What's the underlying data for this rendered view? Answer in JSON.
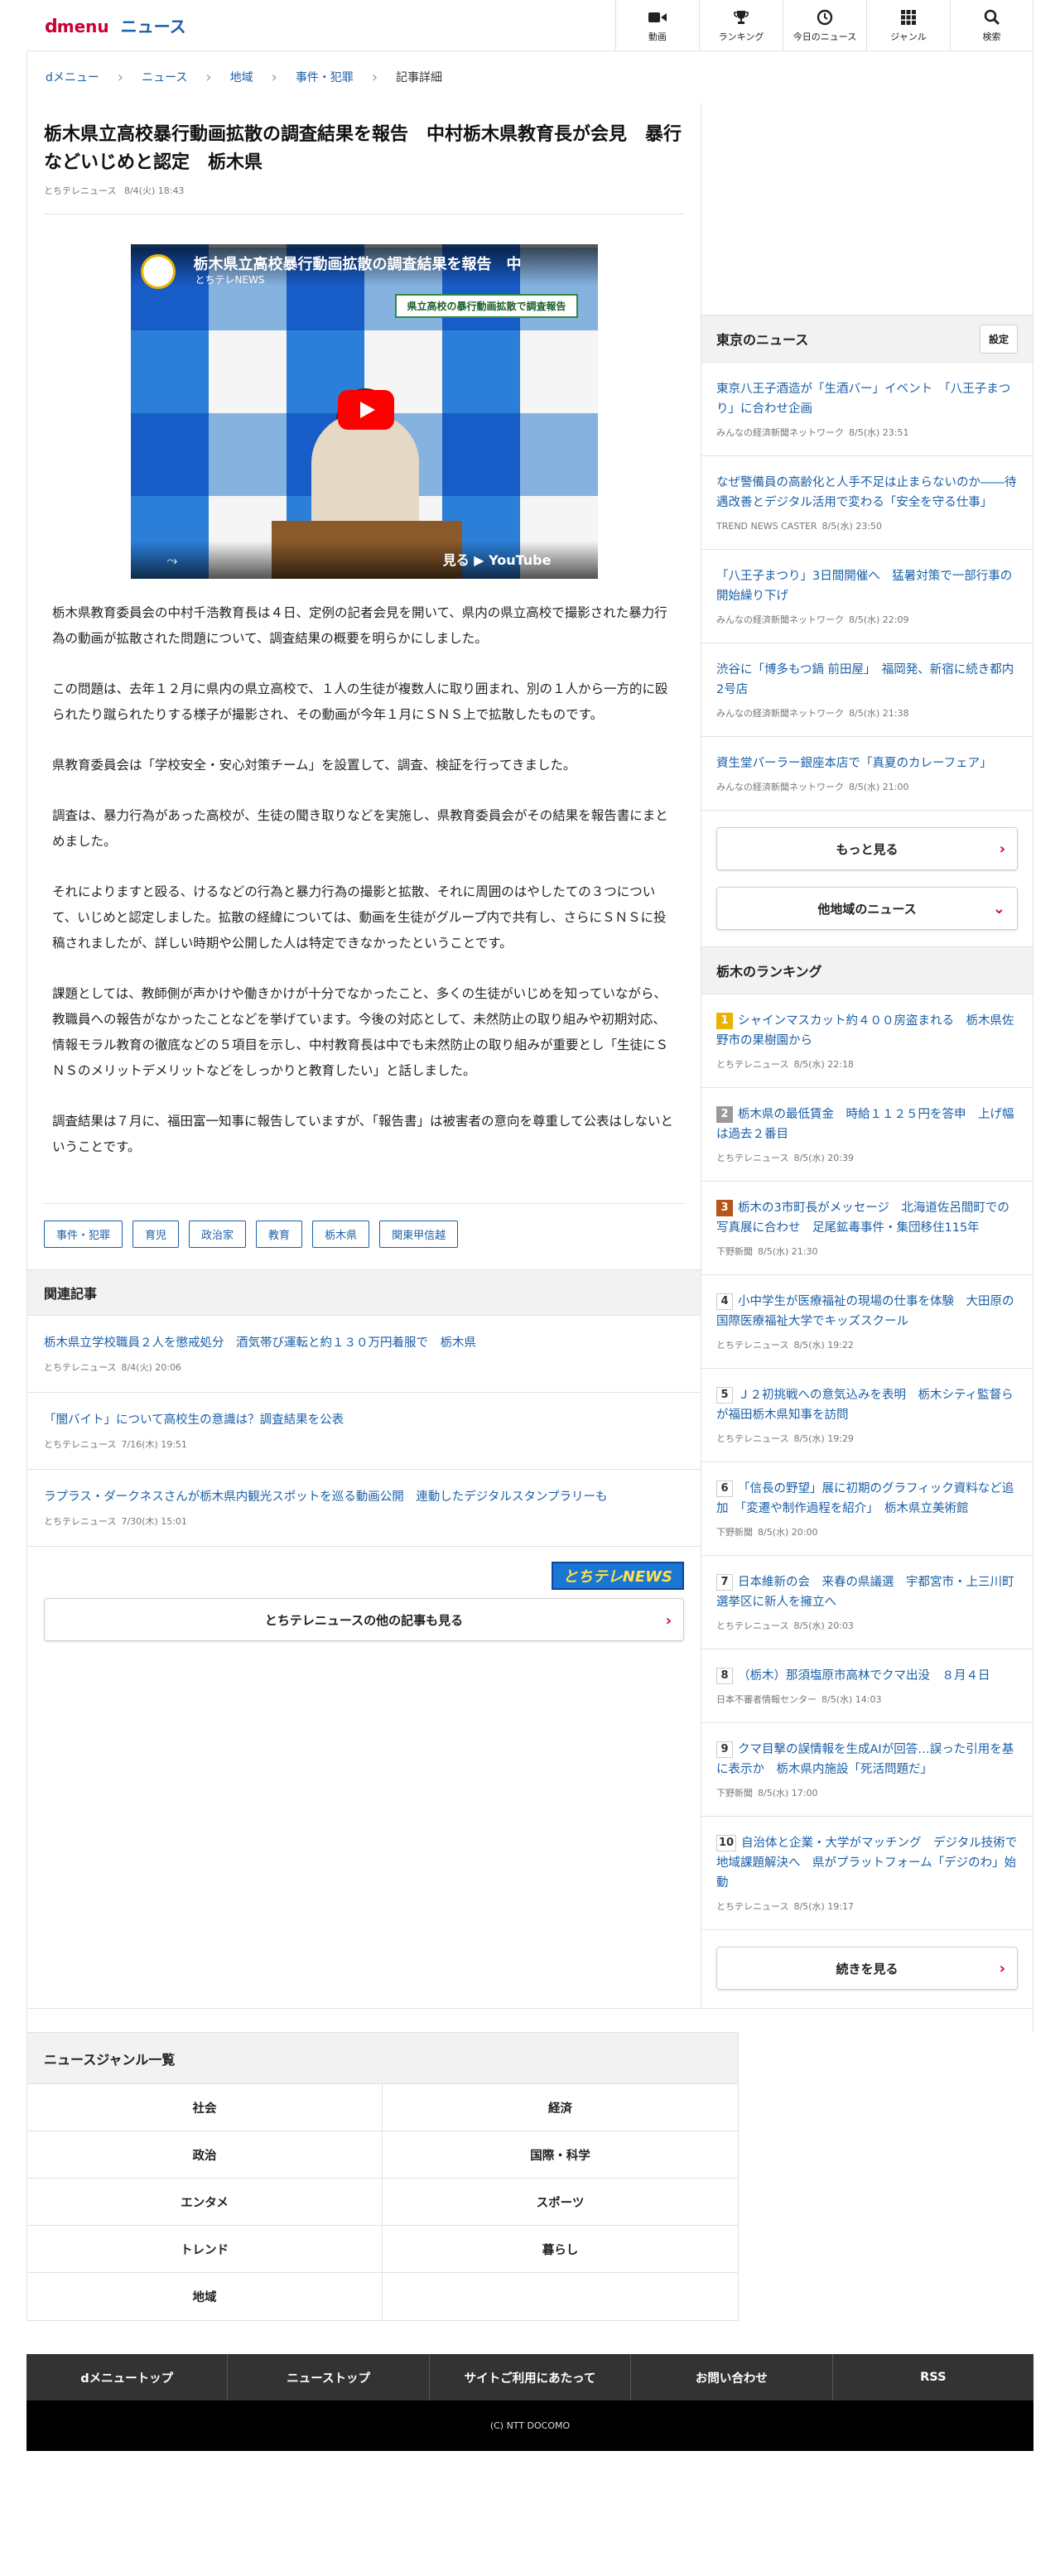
{
  "header": {
    "logo_d": "d",
    "logo_menu": "menu",
    "logo_news": "ニュース",
    "nav": [
      {
        "label": "動画",
        "icon": "video-camera-icon"
      },
      {
        "label": "ランキング",
        "icon": "trophy-icon"
      },
      {
        "label": "今日のニュース",
        "icon": "clock-icon"
      },
      {
        "label": "ジャンル",
        "icon": "grid-icon"
      },
      {
        "label": "検索",
        "icon": "search-icon"
      }
    ]
  },
  "breadcrumb": [
    "dメニュー",
    "ニュース",
    "地域",
    "事件・犯罪",
    "記事詳細"
  ],
  "article": {
    "title": "栃木県立高校暴行動画拡散の調査結果を報告　中村栃木県教育長が会見　暴行などいじめと認定　栃木県",
    "source": "とちテレニュース",
    "date": "8/4(火) 18:43",
    "video": {
      "title": "栃木県立高校暴行動画拡散の調査結果を報告　中",
      "channel": "とちテレNEWS",
      "banner": "県立高校の暴行動画拡散で調査報告",
      "share": "⤳",
      "watch": "見る ▶ YouTube"
    },
    "paragraphs": [
      "栃木県教育委員会の中村千浩教育長は４日、定例の記者会見を開いて、県内の県立高校で撮影された暴力行為の動画が拡散された問題について、調査結果の概要を明らかにしました。",
      "この問題は、去年１２月に県内の県立高校で、１人の生徒が複数人に取り囲まれ、別の１人から一方的に殴られたり蹴られたりする様子が撮影され、その動画が今年１月にＳＮＳ上で拡散したものです。",
      "県教育委員会は「学校安全・安心対策チーム」を設置して、調査、検証を行ってきました。",
      "調査は、暴力行為があった高校が、生徒の聞き取りなどを実施し、県教育委員会がその結果を報告書にまとめました。",
      "それによりますと殴る、けるなどの行為と暴力行為の撮影と拡散、それに周囲のはやしたての３つについて、いじめと認定しました。拡散の経緯については、動画を生徒がグループ内で共有し、さらにＳＮＳに投稿されましたが、詳しい時期や公開した人は特定できなかったということです。",
      "課題としては、教師側が声かけや働きかけが十分でなかったこと、多くの生徒がいじめを知っていながら、教職員への報告がなかったことなどを挙げています。今後の対応として、未然防止の取り組みや初期対応、情報モラル教育の徹底などの５項目を示し、中村教育長は中でも未然防止の取り組みが重要とし「生徒にＳＮＳのメリットデメリットなどをしっかりと教育したい」と話しました。",
      "調査結果は７月に、福田富一知事に報告していますが、「報告書」は被害者の意向を尊重して公表はしないということです。"
    ],
    "tags": [
      "事件・犯罪",
      "育児",
      "政治家",
      "教育",
      "栃木県",
      "関東甲信越"
    ]
  },
  "related": {
    "title": "関連記事",
    "items": [
      {
        "title": "栃木県立学校職員２人を懲戒処分　酒気帯び運転と約１３０万円着服で　栃木県",
        "source": "とちテレニュース",
        "date": "8/4(火) 20:06"
      },
      {
        "title": "「闇バイト」について高校生の意識は？調査結果を公表",
        "source": "とちテレニュース",
        "date": "7/16(木) 19:51"
      },
      {
        "title": "ラプラス・ダークネスさんが栃木県内観光スポットを巡る動画公開　連動したデジタルスタンプラリーも",
        "source": "とちテレニュース",
        "date": "7/30(木) 15:01"
      }
    ],
    "source_logo": "とちテレNEWS",
    "more": "とちテレニュースの他の記事も見る"
  },
  "tokyo": {
    "title": "東京のニュース",
    "setting": "設定",
    "items": [
      {
        "title": "東京八王子酒造が「生酒バー」イベント　「八王子まつり」に合わせ企画",
        "source": "みんなの経済新聞ネットワーク",
        "date": "8/5(水) 23:51"
      },
      {
        "title": "なぜ警備員の高齢化と人手不足は止まらないのか――待遇改善とデジタル活用で変わる「安全を守る仕事」",
        "source": "TREND NEWS CASTER",
        "date": "8/5(水) 23:50"
      },
      {
        "title": "「八王子まつり」3日間開催へ　猛暑対策で一部行事の開始繰り下げ",
        "source": "みんなの経済新聞ネットワーク",
        "date": "8/5(水) 22:09"
      },
      {
        "title": "渋谷に「博多もつ鍋 前田屋」　福岡発、新宿に続き都内2号店",
        "source": "みんなの経済新聞ネットワーク",
        "date": "8/5(水) 21:38"
      },
      {
        "title": "資生堂パーラー銀座本店で「真夏のカレーフェア」",
        "source": "みんなの経済新聞ネットワーク",
        "date": "8/5(水) 21:00"
      }
    ],
    "more": "もっと見る",
    "other": "他地域のニュース"
  },
  "ranking": {
    "title": "栃木のランキング",
    "items": [
      {
        "num": "1",
        "title": "シャインマスカット約４００房盗まれる　栃木県佐野市の果樹園から",
        "source": "とちテレニュース",
        "date": "8/5(水) 22:18"
      },
      {
        "num": "2",
        "title": "栃木県の最低賃金　時給１１２５円を答申　上げ幅は過去２番目",
        "source": "とちテレニュース",
        "date": "8/5(水) 20:39"
      },
      {
        "num": "3",
        "title": "栃木の3市町長がメッセージ　北海道佐呂間町での写真展に合わせ　足尾鉱毒事件・集団移住115年",
        "source": "下野新聞",
        "date": "8/5(水) 21:30"
      },
      {
        "num": "4",
        "title": "小中学生が医療福祉の現場の仕事を体験　大田原の国際医療福祉大学でキッズスクール",
        "source": "とちテレニュース",
        "date": "8/5(水) 19:22"
      },
      {
        "num": "5",
        "title": "Ｊ２初挑戦への意気込みを表明　栃木シティ監督らが福田栃木県知事を訪問",
        "source": "とちテレニュース",
        "date": "8/5(水) 19:29"
      },
      {
        "num": "6",
        "title": "「信長の野望」展に初期のグラフィック資料など追加　「変遷や制作過程を紹介」　栃木県立美術館",
        "source": "下野新聞",
        "date": "8/5(水) 20:00"
      },
      {
        "num": "7",
        "title": "日本維新の会　来春の県議選　宇都宮市・上三川町選挙区に新人を擁立へ",
        "source": "とちテレニュース",
        "date": "8/5(水) 20:03"
      },
      {
        "num": "8",
        "title": "（栃木）那須塩原市高林でクマ出没　８月４日",
        "source": "日本不審者情報センター",
        "date": "8/5(水) 14:03"
      },
      {
        "num": "9",
        "title": "クマ目撃の誤情報を生成AIが回答…誤った引用を基に表示か　栃木県内施設「死活問題だ」",
        "source": "下野新聞",
        "date": "8/5(水) 17:00"
      },
      {
        "num": "10",
        "title": "自治体と企業・大学がマッチング　デジタル技術で地域課題解決へ　県がプラットフォーム「デジのわ」始動",
        "source": "とちテレニュース",
        "date": "8/5(水) 19:17"
      }
    ],
    "more": "続きを見る"
  },
  "genre": {
    "title": "ニュースジャンル一覧",
    "items": [
      "社会",
      "経済",
      "政治",
      "国際・科学",
      "エンタメ",
      "スポーツ",
      "トレンド",
      "暮らし",
      "地域",
      ""
    ]
  },
  "footer": {
    "nav": [
      "dメニュートップ",
      "ニューストップ",
      "サイトご利用にあたって",
      "お問い合わせ",
      "RSS"
    ],
    "copyright": "(C) NTT DOCOMO"
  }
}
